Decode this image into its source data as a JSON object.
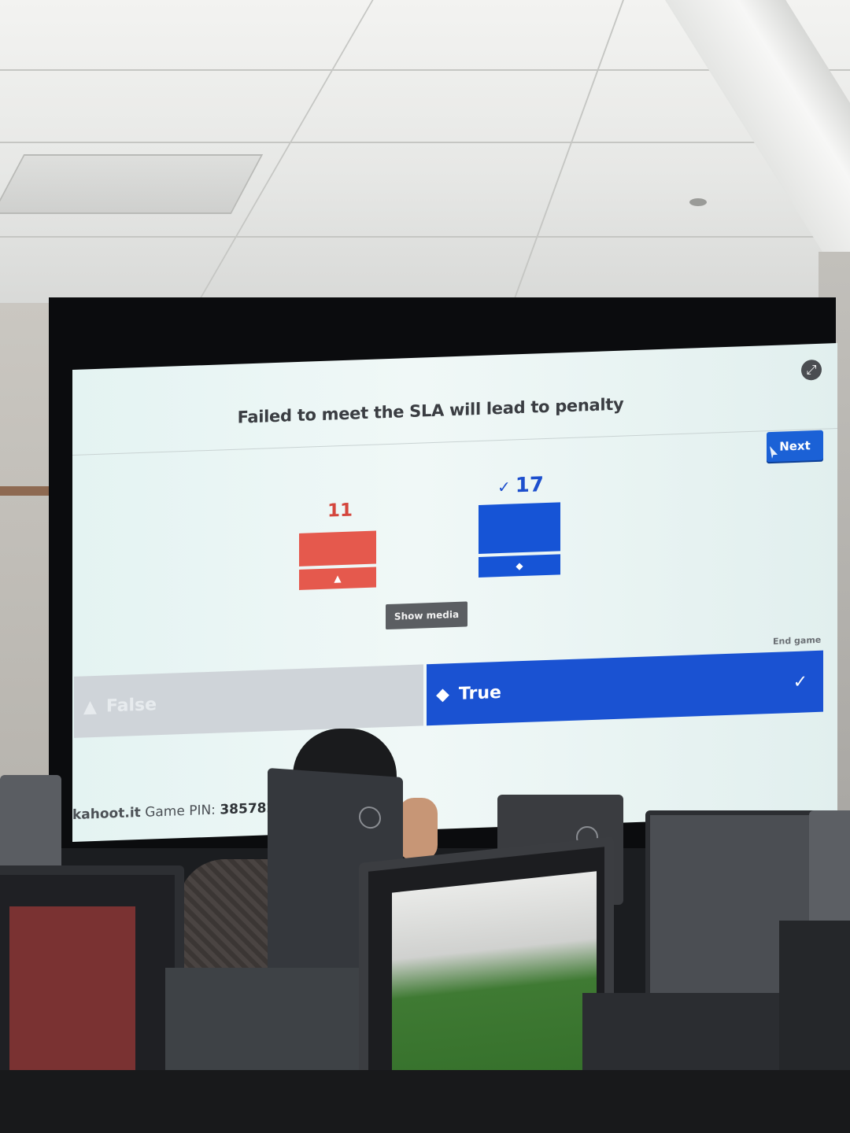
{
  "kahoot": {
    "question": "Failed to meet the SLA will lead to penalty",
    "next_label": "Next",
    "show_media_label": "Show media",
    "end_game_label": "End game",
    "results": [
      {
        "label": "False",
        "count": "11",
        "icon": "triangle-icon",
        "correct": false,
        "color": "#e5594d"
      },
      {
        "label": "True",
        "count": "17",
        "icon": "diamond-icon",
        "correct": true,
        "color": "#1654d6"
      }
    ],
    "answers": {
      "false_label": "False",
      "true_label": "True"
    },
    "correct_mark": "✓",
    "footer": {
      "site": "kahoot.it",
      "pin_label": "Game PIN:",
      "pin": "385782"
    }
  }
}
